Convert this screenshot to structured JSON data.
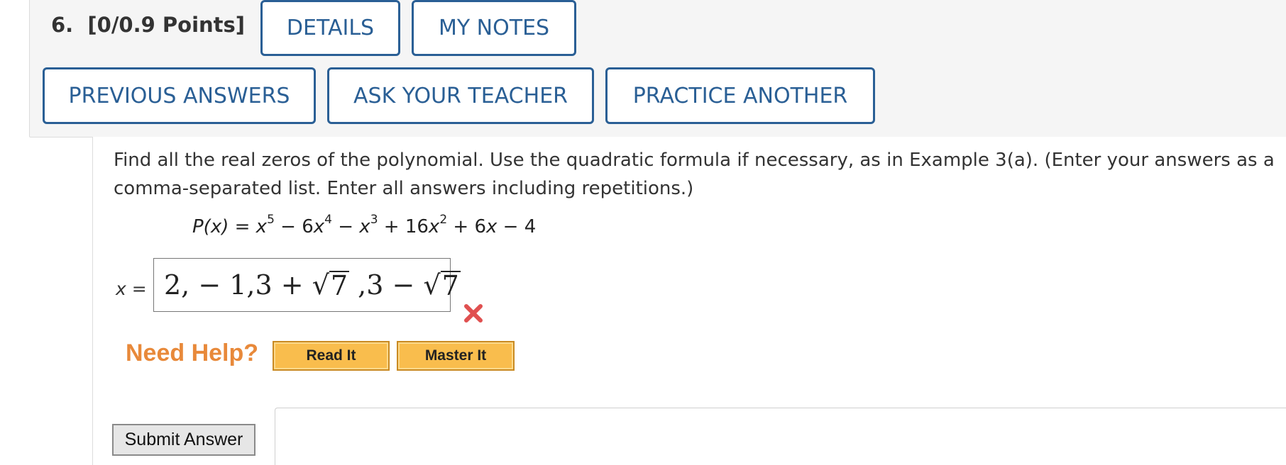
{
  "question": {
    "number": "6.",
    "points": "[0/0.9 Points]",
    "tabs": [
      "DETAILS",
      "MY NOTES"
    ],
    "actions": [
      "PREVIOUS ANSWERS",
      "ASK YOUR TEACHER",
      "PRACTICE ANOTHER"
    ],
    "prompt": "Find all the real zeros of the polynomial. Use the quadratic formula if necessary, as in Example 3(a). (Enter your answers as a comma-separated list. Enter all answers including repetitions.)",
    "formula": {
      "lhs": "P(x) = ",
      "terms": [
        "x",
        "5",
        " − 6",
        "x",
        "4",
        " − ",
        "x",
        "3",
        " + 16",
        "x",
        "2",
        " + 6",
        "x",
        " − 4"
      ]
    },
    "answer_label_var": "x",
    "answer_label_eq": " =",
    "answer": {
      "p1": "2, − 1,3 + ",
      "rad1": "7",
      "p2": " ,3 − ",
      "rad2": "7"
    },
    "status_icon": "wrong-x-icon",
    "help": {
      "title": "Need Help?",
      "buttons": [
        "Read It",
        "Master It"
      ]
    },
    "submit_label": "Submit Answer"
  },
  "colors": {
    "accent": "#2a5f95",
    "help_orange": "#e8893a",
    "help_button": "#f9bd4d",
    "wrong_red": "#e05050"
  }
}
